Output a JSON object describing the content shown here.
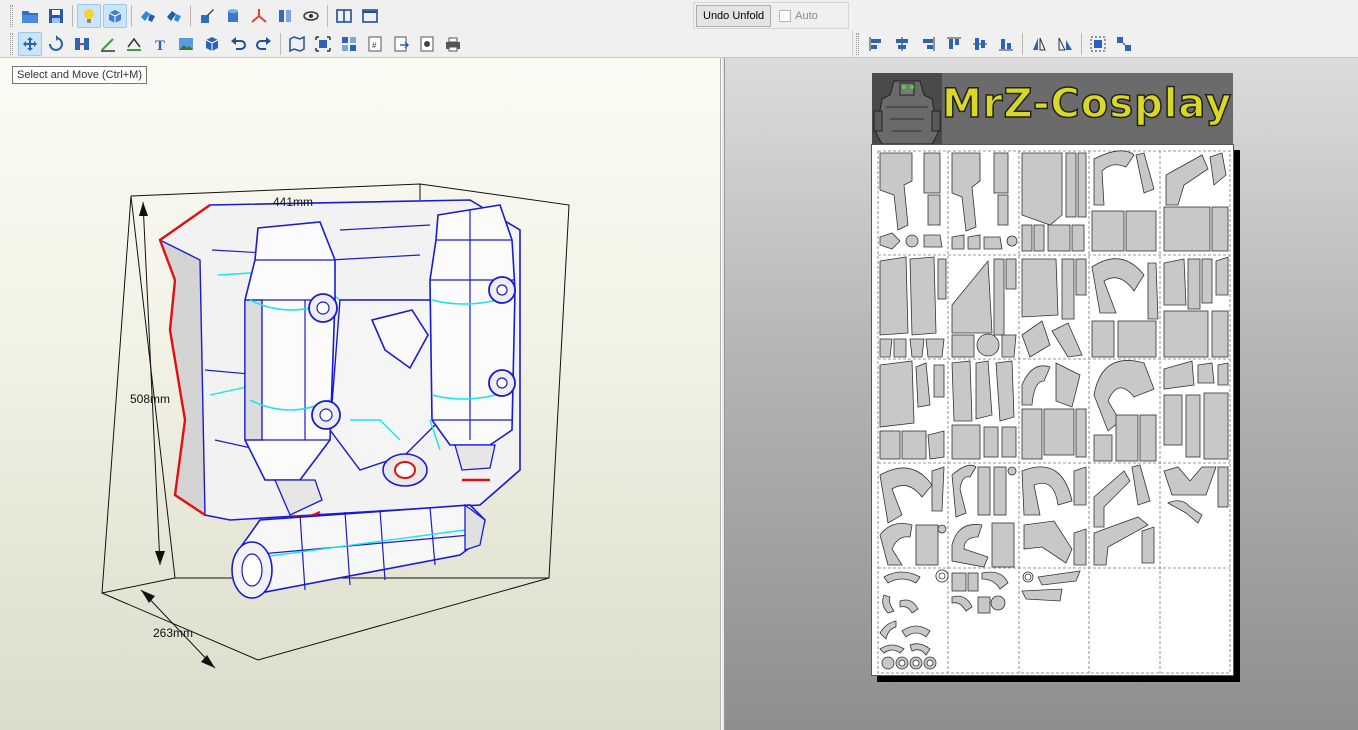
{
  "toolbar": {
    "row1_icons": [
      "open-folder-icon",
      "save-icon",
      "lightbulb-icon",
      "view-3d-icon",
      "unfold-icon",
      "unfold-all-icon",
      "paint-icon",
      "cylinder-icon",
      "axis-icon",
      "split-icon",
      "eye-icon",
      "pane-split-icon",
      "pane-single-icon"
    ],
    "row2_icons": [
      "select-move-icon",
      "rotate-icon",
      "join-icon",
      "edit-line-icon",
      "fold-line-icon",
      "text-icon",
      "image-icon",
      "box-icon",
      "undo-icon",
      "redo-icon",
      "map-icon",
      "fit-icon",
      "arrange-icon",
      "page-number-icon",
      "export-icon",
      "print-settings-icon",
      "print-icon"
    ],
    "row3_icons": [
      "align-left-icon",
      "align-center-icon",
      "align-right-icon",
      "align-top-icon",
      "align-middle-icon",
      "align-bottom-icon",
      "flip-h-icon",
      "flip-v-icon",
      "group-icon",
      "ungroup-icon"
    ],
    "undo_unfold_label": "Undo Unfold",
    "auto_label": "Auto"
  },
  "tooltip": "Select and Move (Ctrl+M)",
  "model": {
    "width_label": "441mm",
    "height_label": "508mm",
    "depth_label": "263mm"
  },
  "sheet": {
    "banner_text": "MrZ-Cosplay",
    "grid_columns": 5,
    "grid_rows": 5
  },
  "colors": {
    "edge_blue": "#1a1ad6",
    "seam_cyan": "#19e6e6",
    "cut_red": "#e01010",
    "part_fill": "#c8c8c8",
    "banner_text": "#d8d825"
  }
}
